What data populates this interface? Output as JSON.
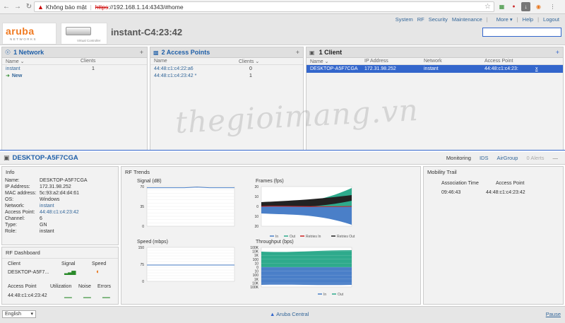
{
  "browser": {
    "not_secure": "Không bảo mật",
    "scheme": "https",
    "url_rest": "://192.168.1.14:4343/#home"
  },
  "header": {
    "vc_name": "instant-C4:23:42",
    "logo_text": "aruba",
    "logo_sub": "NETWORKS",
    "device_sub": "Virtual Controller",
    "nav": [
      "System",
      "RF",
      "Security",
      "Maintenance",
      "More",
      "Help",
      "Logout"
    ]
  },
  "networks": {
    "title": "1 Network",
    "col_name": "Name",
    "col_clients": "Clients",
    "rows": [
      {
        "name": "instant",
        "clients": "1"
      }
    ],
    "new_label": "New"
  },
  "aps": {
    "title": "2 Access Points",
    "col_name": "Name",
    "col_clients": "Clients",
    "rows": [
      {
        "name": "44:48:c1:c4:22:a6",
        "clients": "0"
      },
      {
        "name": "44:48:c1:c4:23:42 *",
        "clients": "1"
      }
    ]
  },
  "clients": {
    "title": "1 Client",
    "cols": [
      "Name",
      "IP Address",
      "Network",
      "Access Point"
    ],
    "rows": [
      {
        "name": "DESKTOP-A5F7CGA",
        "ip": "172.31.98.252",
        "network": "instant",
        "ap": "44:48:c1:c4:23:",
        "x": "x"
      }
    ]
  },
  "client_detail": {
    "title": "DESKTOP-A5F7CGA",
    "tabs": [
      "Monitoring",
      "IDS",
      "AirGroup",
      "0 Alerts"
    ]
  },
  "info": {
    "title": "Info",
    "fields": [
      {
        "k": "Name:",
        "v": "DESKTOP-A5F7CGA"
      },
      {
        "k": "IP Address:",
        "v": "172.31.98.252"
      },
      {
        "k": "MAC address:",
        "v": "5c:93:a2:d4:d4:61"
      },
      {
        "k": "OS:",
        "v": "Windows"
      },
      {
        "k": "Network:",
        "v": "instant"
      },
      {
        "k": "Access Point:",
        "v": "44:48:c1:c4:23:42"
      },
      {
        "k": "Channel:",
        "v": "6"
      },
      {
        "k": "Type:",
        "v": "GN"
      },
      {
        "k": "Role:",
        "v": "instant"
      }
    ]
  },
  "rf_dashboard": {
    "title": "RF Dashboard",
    "client_h": "Client",
    "signal_h": "Signal",
    "speed_h": "Speed",
    "client": "DESKTOP-A5F7...",
    "ap_h": "Access Point",
    "util_h": "Utilization",
    "noise_h": "Noise",
    "errors_h": "Errors",
    "ap": "44:48:c1:c4:23:42"
  },
  "rf_trends": {
    "title": "RF Trends"
  },
  "chart_data": [
    {
      "type": "line",
      "title": "Signal   (dB)",
      "ylim": [
        0,
        70
      ],
      "yticks": [
        "70",
        "35",
        "0"
      ],
      "series": [
        {
          "values": [
            68,
            68,
            68,
            68,
            69,
            68,
            68,
            68
          ]
        }
      ]
    },
    {
      "type": "area",
      "title": "Frames   (fps)",
      "yticks": [
        "20",
        "10",
        "0",
        "10",
        "20"
      ],
      "legend": [
        "In",
        "Out",
        "Retries In",
        "Retries Out"
      ],
      "colors": [
        "#4a7fc8",
        "#2eaa8c",
        "#cc2222",
        "#222222"
      ]
    },
    {
      "type": "line",
      "title": "Speed   (mbps)",
      "ylim": [
        0,
        150
      ],
      "yticks": [
        "150",
        "75",
        "0"
      ],
      "series": [
        {
          "values": [
            72,
            72,
            72,
            72,
            72,
            72,
            72,
            72
          ]
        }
      ]
    },
    {
      "type": "area",
      "title": "Throughput   (bps)",
      "yticks": [
        "100K",
        "10K",
        "1K",
        "100",
        "10",
        "0",
        "10",
        "100",
        "1K",
        "10K",
        "100K"
      ],
      "legend": [
        "In",
        "Out"
      ],
      "colors": [
        "#4a7fc8",
        "#2eaa8c"
      ]
    }
  ],
  "mobility": {
    "title": "Mobility Trail",
    "col_time": "Association Time",
    "col_ap": "Access Point",
    "time": "09:46:43",
    "ap": "44:48:c1:c4:23:42"
  },
  "footer": {
    "language": "English",
    "brand": "Aruba Central",
    "pause": "Pause"
  },
  "watermark": "thegioimang.vn"
}
